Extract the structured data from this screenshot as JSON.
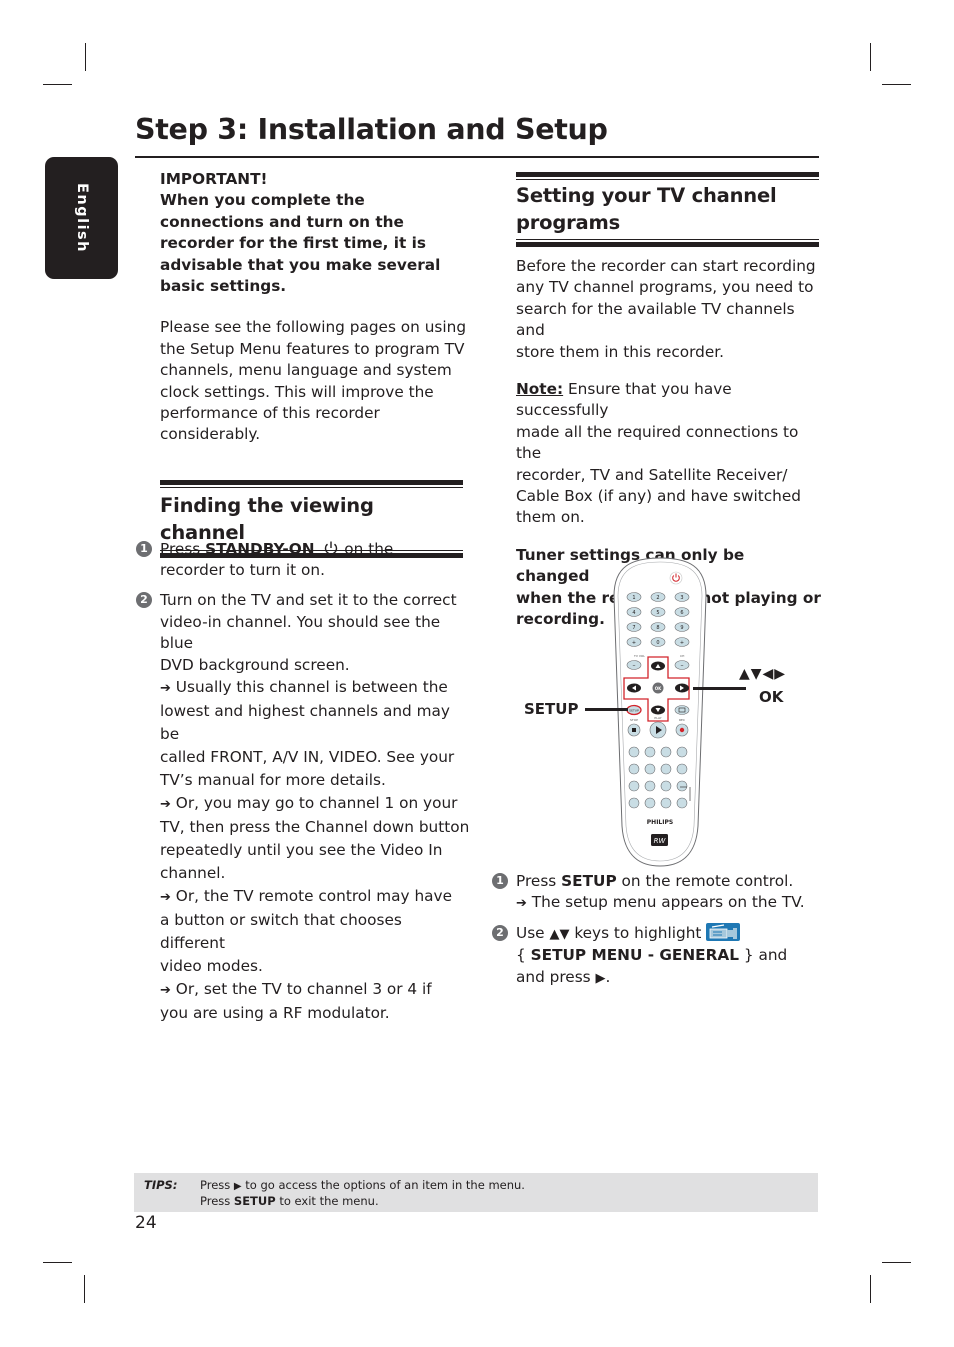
{
  "page": {
    "title": "Step 3: Installation and Setup",
    "language_tab": "English",
    "page_number": "24"
  },
  "important": {
    "heading": "IMPORTANT!",
    "bold_text": "When you complete the connections and turn on the recorder for the first time, it is advisable that you make several basic settings.",
    "bold_lines": [
      "When you complete the",
      "connections and turn on the",
      "recorder for the first time, it is",
      "advisable that you make several",
      "basic settings."
    ],
    "body_lines": [
      "Please see the following pages on using",
      "the Setup Menu features to program TV",
      "channels, menu language and system",
      "clock settings. This will improve the",
      "performance of this recorder",
      "considerably."
    ]
  },
  "finding_channel": {
    "heading": "Finding the viewing channel",
    "steps": [
      {
        "number": "1",
        "prefix": "Press ",
        "bold": "STANDBY-ON",
        "icon": "power-icon",
        "suffix_line1": " on the",
        "line2": "recorder to turn it on."
      },
      {
        "number": "2",
        "lines": [
          "Turn on the TV and set it to the correct",
          "video-in channel. You should see the blue",
          "DVD background screen."
        ],
        "results": [
          [
            "Usually this channel is between the",
            "lowest and highest channels and may be",
            "called FRONT, A/V IN, VIDEO. See your",
            "TV’s manual for more details."
          ],
          [
            "Or, you may go to channel 1 on your",
            "TV, then press the Channel down button",
            "repeatedly until you see the Video In",
            "channel."
          ],
          [
            "Or, the TV remote control may have",
            "a button or switch that chooses different",
            "video modes."
          ],
          [
            "Or, set the TV to channel 3 or 4 if",
            "you are using a RF modulator."
          ]
        ]
      }
    ]
  },
  "setting_channels": {
    "heading_line1": "Setting your TV channel",
    "heading_line2": "programs",
    "intro_lines": [
      "Before the recorder can start recording",
      "any TV channel programs, you need to",
      "search for the available TV channels and",
      "store them in this recorder."
    ],
    "note_label": "Note:",
    "note_lines": [
      " Ensure that you have successfully",
      "made all the required connections to the",
      "recorder, TV and Satellite Receiver/",
      "Cable Box (if any) and have switched",
      "them on."
    ],
    "warning_lines": [
      "Tuner settings can only be changed",
      "when the recorder is not playing or",
      "recording."
    ],
    "remote": {
      "callout_setup": "SETUP",
      "callout_arrows": "▲▼◀▶",
      "callout_ok": "OK",
      "brand": "PHILIPS",
      "logo": "RW",
      "keypad": [
        "1",
        "2",
        "3",
        "4",
        "5",
        "6",
        "7",
        "8",
        "9",
        "+",
        "0",
        "+"
      ],
      "accent_color": "#d2232a"
    },
    "steps": [
      {
        "number": "1",
        "prefix": "Press ",
        "bold": "SETUP",
        "suffix": " on the remote control.",
        "result": "The setup menu appears on the TV."
      },
      {
        "number": "2",
        "prefix": "Use ",
        "keys": "▲▼",
        "mid": " keys to highlight ",
        "icon": "setup-camera-icon",
        "line2_open": "{ ",
        "line2_bold": "SETUP MENU - GENERAL",
        "line2_close": " } and",
        "line3_prefix": "and press ",
        "line3_key": "▶",
        "line3_suffix": "."
      }
    ]
  },
  "tips": {
    "label": "TIPS:",
    "line1_prefix": "Press ",
    "line1_key": "▶",
    "line1_suffix": " to go access the options of an item in the menu.",
    "line2_prefix": "Press ",
    "line2_bold": "SETUP",
    "line2_suffix": " to exit the menu."
  },
  "symbols": {
    "arrow": "➔"
  }
}
